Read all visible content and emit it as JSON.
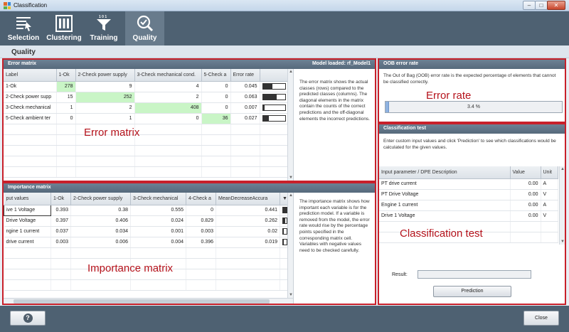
{
  "window": {
    "title": "Classification",
    "min": "–",
    "max": "□",
    "close": "✕"
  },
  "toolbar": [
    {
      "label": "Selection",
      "icon": "selection-icon"
    },
    {
      "label": "Clustering",
      "icon": "clustering-icon"
    },
    {
      "label": "Training",
      "icon": "filter-icon"
    },
    {
      "label": "Quality",
      "icon": "quality-icon",
      "active": true
    }
  ],
  "section_title": "Quality",
  "error_matrix": {
    "title": "Error matrix",
    "model_loaded": "Model loaded: rf_Model1",
    "overlay": "Error matrix",
    "columns": [
      "Label",
      "1-Ok",
      "2-Check power supply",
      "3-Check mechanical cond.",
      "5-Check a",
      "Error rate",
      ""
    ],
    "rows": [
      {
        "label": "1-Ok",
        "values": [
          "278",
          "9",
          "4",
          "0"
        ],
        "error": "0.045",
        "bar": 0.045
      },
      {
        "label": "2-Check power supp",
        "values": [
          "15",
          "252",
          "2",
          "0"
        ],
        "error": "0.063",
        "bar": 0.063
      },
      {
        "label": "3-Check mechanical",
        "values": [
          "1",
          "2",
          "408",
          "0"
        ],
        "error": "0.007",
        "bar": 0.007
      },
      {
        "label": "5-Check ambient ter",
        "values": [
          "0",
          "1",
          "0",
          "36"
        ],
        "error": "0.027",
        "bar": 0.027
      }
    ],
    "description": "The error matrix shows the actual classes (rows) compared to the predicted classes (columns). The diagonal elements in the matrix contain the counts of the correct predictions and the off-diagonal elements the incorrect predictions."
  },
  "importance_matrix": {
    "title": "Importance matrix",
    "overlay": "Importance matrix",
    "columns": [
      "put values",
      "1-Ok",
      "2-Check power supply",
      "3-Check mechanical",
      "4-Check a",
      "MeanDecreaseAccura",
      ""
    ],
    "rows": [
      {
        "label": "ive 1 Voltage",
        "values": [
          "0.393",
          "0.38",
          "0.555",
          "0"
        ],
        "mda": "0.441",
        "bar": 0.441
      },
      {
        "label": "Drive Voltage",
        "values": [
          "0.397",
          "0.406",
          "0.024",
          "0.829"
        ],
        "mda": "0.262",
        "bar": 0.262
      },
      {
        "label": "ngine 1 current",
        "values": [
          "0.037",
          "0.034",
          "0.001",
          "0.003"
        ],
        "mda": "0.02",
        "bar": 0.02
      },
      {
        "label": "drive current",
        "values": [
          "0.003",
          "0.006",
          "0.004",
          "0.396"
        ],
        "mda": "0.019",
        "bar": 0.019
      }
    ],
    "description": "The importance matrix shows how important each variable is for the prediction model. If a variable is removed from the model, the error rate would rise by the percentage points specified in the corresponding matrix cell. Variables with negative values need to be checked carefully."
  },
  "oob": {
    "title": "OOB error rate",
    "description": "The Out of Bag (OOB) error rate is the expected percentage of elements that cannot be classified correctly.",
    "overlay": "Error rate",
    "value_text": "3.4 %",
    "value": 0.034
  },
  "classification_test": {
    "title": "Classification test",
    "description": "Enter custom input values and click 'Prediction' to see which classifications would be calculated for the given values.",
    "columns": [
      "Input parameter / DPE Description",
      "Value",
      "Unit"
    ],
    "rows": [
      {
        "param": "PT drive current",
        "value": "0.00",
        "unit": "A"
      },
      {
        "param": "PT Drive Voltage",
        "value": "0.00",
        "unit": "V"
      },
      {
        "param": "Engine 1 current",
        "value": "0.00",
        "unit": "A"
      },
      {
        "param": "Drive 1 Voltage",
        "value": "0.00",
        "unit": "V"
      }
    ],
    "overlay": "Classification test",
    "result_label": "Result:",
    "result_value": "",
    "prediction_button": "Prediction"
  },
  "footer": {
    "help": "?",
    "close": "Close"
  }
}
